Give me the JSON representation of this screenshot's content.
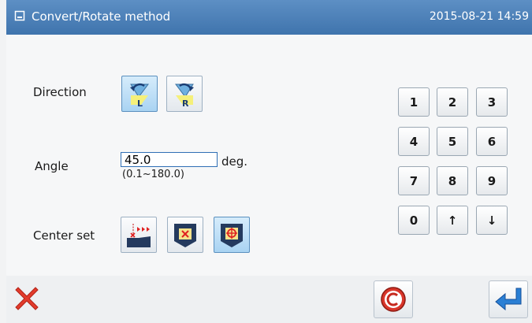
{
  "window": {
    "title": "Convert/Rotate method",
    "datetime": "2015-08-21 14:59"
  },
  "direction": {
    "label": "Direction",
    "buttons": [
      {
        "label": "L",
        "icon": "rotate-left-icon",
        "selected": true
      },
      {
        "label": "R",
        "icon": "rotate-right-icon",
        "selected": false
      }
    ]
  },
  "angle": {
    "label": "Angle",
    "value": "45.0",
    "unit": "deg.",
    "range": "(0.1~180.0)"
  },
  "center_set": {
    "label": "Center set",
    "buttons": [
      {
        "icon": "center-point-pattern-icon",
        "selected": false
      },
      {
        "icon": "center-x-mark-icon",
        "selected": false
      },
      {
        "icon": "center-crosshair-icon",
        "selected": true
      }
    ]
  },
  "keypad": {
    "keys": [
      "1",
      "2",
      "3",
      "4",
      "5",
      "6",
      "7",
      "8",
      "9",
      "0",
      "↑",
      "↓"
    ]
  },
  "footer": {
    "cancel_icon": "close-x-icon",
    "clear_icon": "clear-c-icon",
    "enter_icon": "enter-return-icon"
  },
  "colors": {
    "titlebar": "#4a7fb8",
    "selected_button": "#a9d3f2",
    "cancel_red": "#e23b2c",
    "enter_blue": "#2a7fd4"
  }
}
